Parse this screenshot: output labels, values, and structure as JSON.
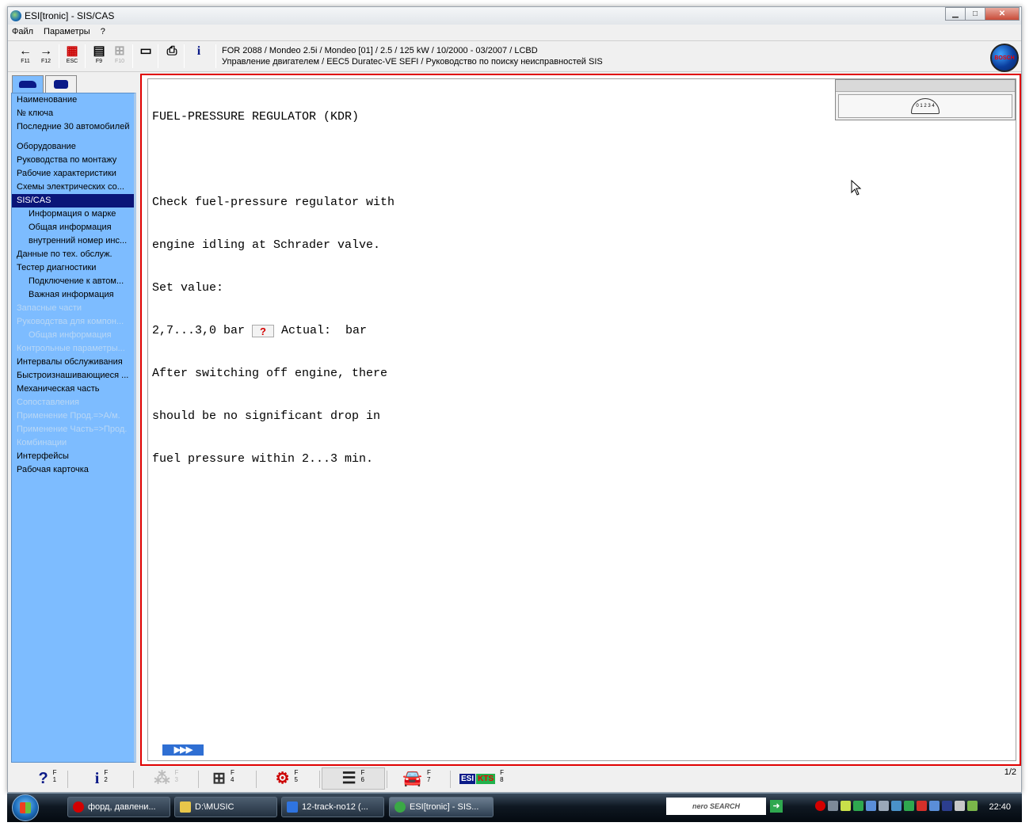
{
  "window": {
    "title": "ESI[tronic] - SIS/CAS",
    "buttons": {
      "minimize": "▁",
      "maximize": "□",
      "close": "✕"
    }
  },
  "menu": [
    "Файл",
    "Параметры",
    "?"
  ],
  "toolbar": {
    "buttons": [
      {
        "name": "back",
        "glyph": "←",
        "key": "F11"
      },
      {
        "name": "forward",
        "glyph": "→",
        "key": "F12"
      },
      {
        "name": "esc",
        "glyph": "▦",
        "key": "ESC"
      },
      {
        "name": "f9",
        "glyph": "▤",
        "key": "F9"
      },
      {
        "name": "f10",
        "glyph": "⊞",
        "key": "F10"
      },
      {
        "name": "document",
        "glyph": "▭",
        "key": ""
      },
      {
        "name": "print",
        "glyph": "⎙",
        "key": ""
      },
      {
        "name": "info",
        "glyph": "i",
        "key": ""
      }
    ],
    "vehicle_line1": "FOR 2088 / Mondeo 2.5i / Mondeo [01] / 2.5 / 125 kW / 10/2000 - 03/2007 / LCBD",
    "vehicle_line2": "Управление двигателем / EEC5 Duratec-VE SEFI / Руководство по поиску неисправностей SIS",
    "logo_text": "BOSCH"
  },
  "sidebar": {
    "groups": [
      [
        {
          "label": "Наименование",
          "level": 0,
          "state": "normal"
        },
        {
          "label": "№ ключа",
          "level": 0,
          "state": "normal"
        },
        {
          "label": "Последние 30 автомобилей",
          "level": 0,
          "state": "normal"
        }
      ],
      [
        {
          "label": "Оборудование",
          "level": 0,
          "state": "normal"
        },
        {
          "label": "Руководства по монтажу",
          "level": 0,
          "state": "normal"
        },
        {
          "label": "Рабочие характеристики",
          "level": 0,
          "state": "normal"
        },
        {
          "label": "Схемы электрических со...",
          "level": 0,
          "state": "normal"
        },
        {
          "label": "SIS/CAS",
          "level": 0,
          "state": "selected"
        },
        {
          "label": "Информация о марке",
          "level": 1,
          "state": "normal"
        },
        {
          "label": "Общая информация",
          "level": 1,
          "state": "normal"
        },
        {
          "label": "внутренний номер инс...",
          "level": 1,
          "state": "normal"
        },
        {
          "label": "Данные по тех. обслуж.",
          "level": 0,
          "state": "normal"
        },
        {
          "label": "Тестер диагностики",
          "level": 0,
          "state": "normal"
        },
        {
          "label": "Подключение к автом...",
          "level": 1,
          "state": "normal"
        },
        {
          "label": "Важная информация",
          "level": 1,
          "state": "normal"
        },
        {
          "label": "Запасные части",
          "level": 0,
          "state": "disabled"
        },
        {
          "label": "Руководства для компон...",
          "level": 0,
          "state": "disabled"
        },
        {
          "label": "Общая информация",
          "level": 1,
          "state": "disabled"
        },
        {
          "label": "Контрольные параметры...",
          "level": 0,
          "state": "disabled"
        },
        {
          "label": "Интервалы обслуживания",
          "level": 0,
          "state": "normal"
        },
        {
          "label": "Быстроизнашивающиеся ...",
          "level": 0,
          "state": "normal"
        },
        {
          "label": "Механическая часть",
          "level": 0,
          "state": "normal"
        },
        {
          "label": "Сопоставления",
          "level": 0,
          "state": "disabled"
        },
        {
          "label": "Применение Прод.=>А/м.",
          "level": 0,
          "state": "disabled"
        },
        {
          "label": "Применение Часть=>Прод.",
          "level": 0,
          "state": "disabled"
        },
        {
          "label": "Комбинации",
          "level": 0,
          "state": "disabled"
        },
        {
          "label": "Интерфейсы",
          "level": 0,
          "state": "normal"
        },
        {
          "label": "Рабочая карточка",
          "level": 0,
          "state": "normal"
        }
      ]
    ]
  },
  "document": {
    "title": "FUEL-PRESSURE REGULATOR (KDR)",
    "para1": [
      "Check fuel-pressure regulator with",
      "engine idling at Schrader valve.",
      "Set value:"
    ],
    "value_prefix": "2,7...3,0 bar ",
    "help_glyph": "?",
    "value_suffix": " Actual:  bar",
    "para2": [
      "After switching off engine, there",
      "should be no significant drop in",
      "fuel pressure within 2...3 min."
    ],
    "gauge_label": "0 1 2 3 4",
    "next_label": "▶▶▶"
  },
  "fkeys": [
    {
      "name": "help",
      "icon": "?",
      "num": "F\n1",
      "state": "normal"
    },
    {
      "name": "info",
      "icon": "i",
      "num": "F\n2",
      "state": "normal"
    },
    {
      "name": "f3",
      "icon": "⁂",
      "num": "F\n3",
      "state": "disabled"
    },
    {
      "name": "f4",
      "icon": "⊞",
      "num": "F\n4",
      "state": "normal"
    },
    {
      "name": "f5",
      "icon": "⚙",
      "num": "F\n5",
      "state": "normal"
    },
    {
      "name": "f6",
      "icon": "☰",
      "num": "F\n6",
      "state": "active"
    },
    {
      "name": "f7",
      "icon": "🚘",
      "num": "F\n7",
      "state": "normal"
    }
  ],
  "fkey8": {
    "esi": "ESI",
    "kts": "KTS",
    "num": "F\n8"
  },
  "page_count": "1/2",
  "taskbar": {
    "tasks": [
      {
        "label": "форд, давлени...",
        "icon_color": "#d40000",
        "active": false
      },
      {
        "label": "D:\\MUSIC",
        "icon_color": "#e8c64a",
        "active": false
      },
      {
        "label": "12-track-no12 (...",
        "icon_color": "#2f74e0",
        "active": false
      },
      {
        "label": "ESI[tronic] - SIS...",
        "icon_color": "#3aa845",
        "active": true
      }
    ],
    "nero_label": "nero SEARCH",
    "clock": "22:40"
  }
}
